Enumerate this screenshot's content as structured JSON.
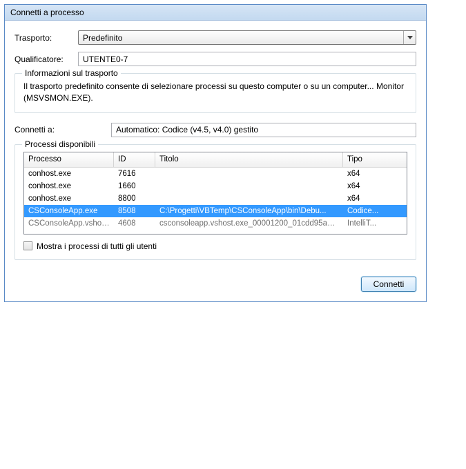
{
  "window": {
    "title": "Connetti a processo"
  },
  "transport": {
    "label": "Trasporto:",
    "value": "Predefinito"
  },
  "qualifier": {
    "label": "Qualificatore:",
    "value": "UTENTE0-7"
  },
  "transport_info": {
    "title": "Informazioni sul trasporto",
    "text": "Il trasporto predefinito consente di selezionare processi su questo computer o su un computer... Monitor (MSVSMON.EXE)."
  },
  "attach_to": {
    "label": "Connetti a:",
    "value": "Automatico: Codice (v4.5, v4.0) gestito"
  },
  "processes": {
    "group_title": "Processi disponibili",
    "columns": {
      "process": "Processo",
      "id": "ID",
      "title": "Titolo",
      "type": "Tipo"
    },
    "rows": [
      {
        "process": "conhost.exe",
        "id": "7616",
        "title": "",
        "type": "x64",
        "selected": false,
        "disabled": false
      },
      {
        "process": "conhost.exe",
        "id": "1660",
        "title": "",
        "type": "x64",
        "selected": false,
        "disabled": false
      },
      {
        "process": "conhost.exe",
        "id": "8800",
        "title": "",
        "type": "x64",
        "selected": false,
        "disabled": false
      },
      {
        "process": "CSConsoleApp.exe",
        "id": "8508",
        "title": "C:\\Progetti\\VBTemp\\CSConsoleApp\\bin\\Debu...",
        "type": "Codice...",
        "selected": true,
        "disabled": false
      },
      {
        "process": "CSConsoleApp.vshos...",
        "id": "4608",
        "title": "csconsoleapp.vshost.exe_00001200_01cdd95a41...",
        "type": "IntelliT...",
        "selected": false,
        "disabled": true
      }
    ],
    "show_all_label": "Mostra i processi di tutti gli utenti"
  },
  "buttons": {
    "connect": "Connetti"
  }
}
